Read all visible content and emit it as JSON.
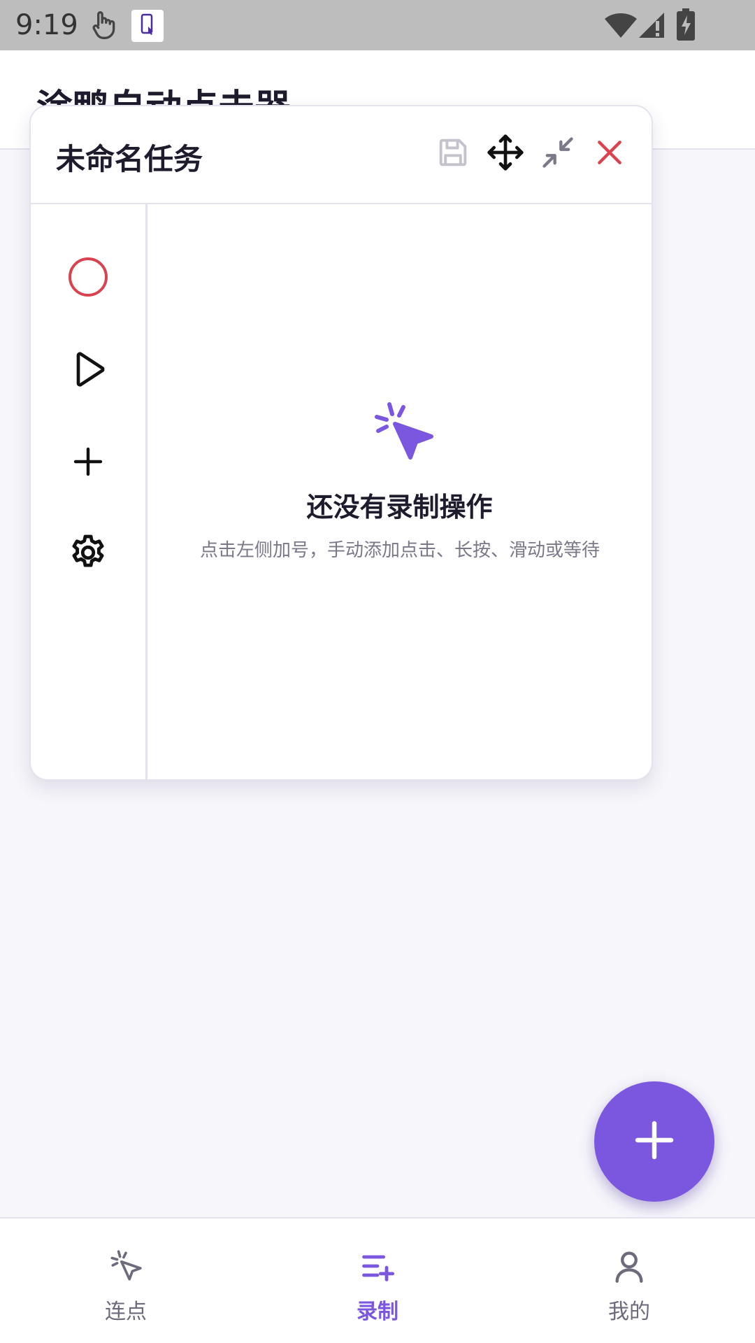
{
  "status_bar": {
    "time": "9:19",
    "icons": [
      "touch-icon",
      "phone-touch-app-icon",
      "wifi-icon",
      "signal-icon",
      "battery-charging-icon"
    ]
  },
  "header": {
    "title": "涂鸭自动点击器"
  },
  "panel": {
    "title": "未命名任务",
    "header_icons": [
      "save-icon",
      "move-icon",
      "minimize-icon",
      "close-icon"
    ],
    "sidebar_icons": [
      "record-icon",
      "play-icon",
      "add-icon",
      "settings-icon"
    ],
    "empty_state": {
      "icon": "cursor-click-icon",
      "title": "还没有录制操作",
      "description": "点击左侧加号，手动添加点击、长按、滑动或等待"
    }
  },
  "fab": {
    "icon": "plus-icon"
  },
  "bottom_nav": {
    "items": [
      {
        "label": "连点",
        "icon": "cursor-click-icon",
        "active": false
      },
      {
        "label": "录制",
        "icon": "list-add-icon",
        "active": true
      },
      {
        "label": "我的",
        "icon": "person-icon",
        "active": false
      }
    ]
  },
  "colors": {
    "accent": "#7b57e0",
    "danger": "#d8434f",
    "background": "#f7f6fb",
    "text": "#1d1b2c",
    "muted": "#7b7889"
  }
}
